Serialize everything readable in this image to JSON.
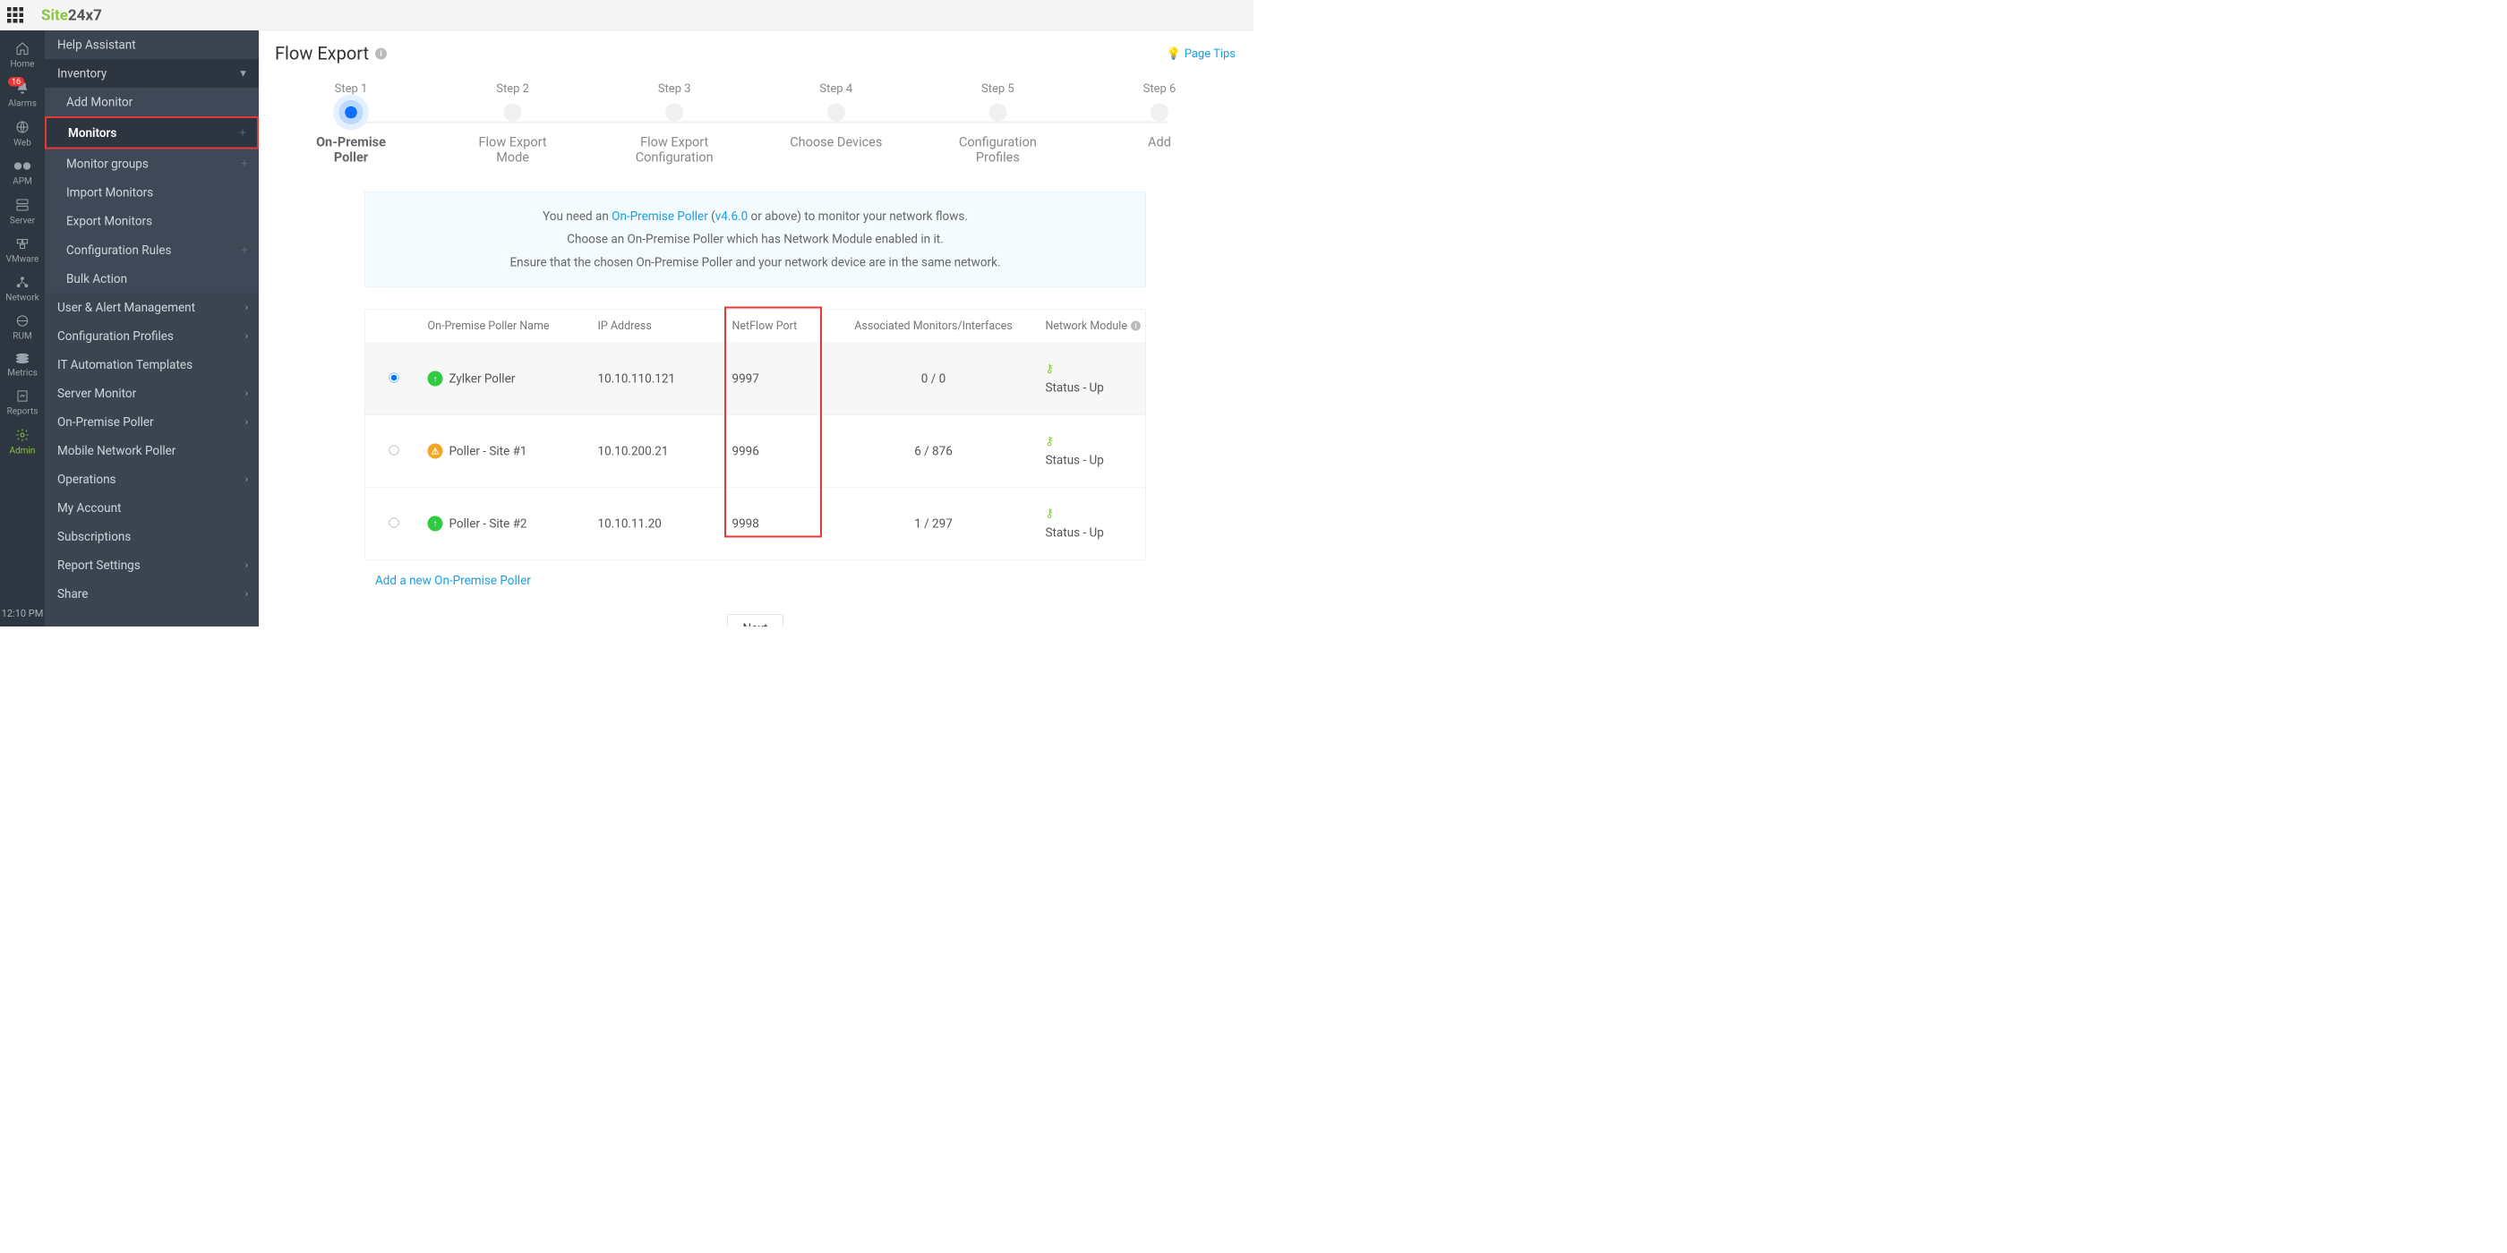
{
  "logo": {
    "part1": "Site",
    "part2": "24x7"
  },
  "iconrail": {
    "items": [
      {
        "label": "Home",
        "key": "home"
      },
      {
        "label": "Alarms",
        "key": "alarms",
        "badge": "16"
      },
      {
        "label": "Web",
        "key": "web"
      },
      {
        "label": "APM",
        "key": "apm"
      },
      {
        "label": "Server",
        "key": "server"
      },
      {
        "label": "VMware",
        "key": "vmware"
      },
      {
        "label": "Network",
        "key": "network"
      },
      {
        "label": "RUM",
        "key": "rum"
      },
      {
        "label": "Metrics",
        "key": "metrics"
      },
      {
        "label": "Reports",
        "key": "reports"
      },
      {
        "label": "Admin",
        "key": "admin",
        "active": true
      }
    ],
    "time": "12:10 PM"
  },
  "sidebar": {
    "help": "Help Assistant",
    "inventory": "Inventory",
    "sub": {
      "add_monitor": "Add Monitor",
      "monitors": "Monitors",
      "monitor_groups": "Monitor groups",
      "import_monitors": "Import Monitors",
      "export_monitors": "Export Monitors",
      "config_rules": "Configuration Rules",
      "bulk_action": "Bulk Action"
    },
    "user_alert": "User & Alert Management",
    "config_profiles": "Configuration Profiles",
    "it_automation": "IT Automation Templates",
    "server_monitor": "Server Monitor",
    "onpremise_poller": "On-Premise Poller",
    "mobile_poller": "Mobile Network Poller",
    "operations": "Operations",
    "my_account": "My Account",
    "subscriptions": "Subscriptions",
    "report_settings": "Report Settings",
    "share": "Share"
  },
  "page": {
    "title": "Flow Export",
    "pagetips": "Page Tips"
  },
  "stepper": [
    {
      "top": "Step 1",
      "bot": "On-Premise Poller",
      "active": true
    },
    {
      "top": "Step 2",
      "bot": "Flow Export Mode"
    },
    {
      "top": "Step 3",
      "bot": "Flow Export Configuration"
    },
    {
      "top": "Step 4",
      "bot": "Choose Devices"
    },
    {
      "top": "Step 5",
      "bot": "Configuration Profiles"
    },
    {
      "top": "Step 6",
      "bot": "Add"
    }
  ],
  "notice": {
    "line1_a": "You need an ",
    "line1_link": "On-Premise Poller",
    "line1_b": " (",
    "line1_ver": "v4.6.0",
    "line1_c": " or above) to monitor your network flows.",
    "line2": "Choose an On-Premise Poller which has Network Module enabled in it.",
    "line3": "Ensure that the chosen On-Premise Poller and your network device are in the same network."
  },
  "table": {
    "headers": {
      "name": "On-Premise Poller Name",
      "ip": "IP Address",
      "port": "NetFlow Port",
      "assoc": "Associated Monitors/Interfaces",
      "module": "Network Module"
    },
    "rows": [
      {
        "selected": true,
        "status": "up",
        "name": "Zylker Poller",
        "ip": "10.10.110.121",
        "port": "9997",
        "assoc": "0 / 0",
        "module": "Status - Up"
      },
      {
        "selected": false,
        "status": "warn",
        "name": "Poller - Site #1",
        "ip": "10.10.200.21",
        "port": "9996",
        "assoc": "6 / 876",
        "module": "Status - Up"
      },
      {
        "selected": false,
        "status": "up",
        "name": "Poller - Site #2",
        "ip": "10.10.11.20",
        "port": "9998",
        "assoc": "1 / 297",
        "module": "Status - Up"
      }
    ]
  },
  "add_link": "Add a new On-Premise Poller",
  "next": "Next"
}
